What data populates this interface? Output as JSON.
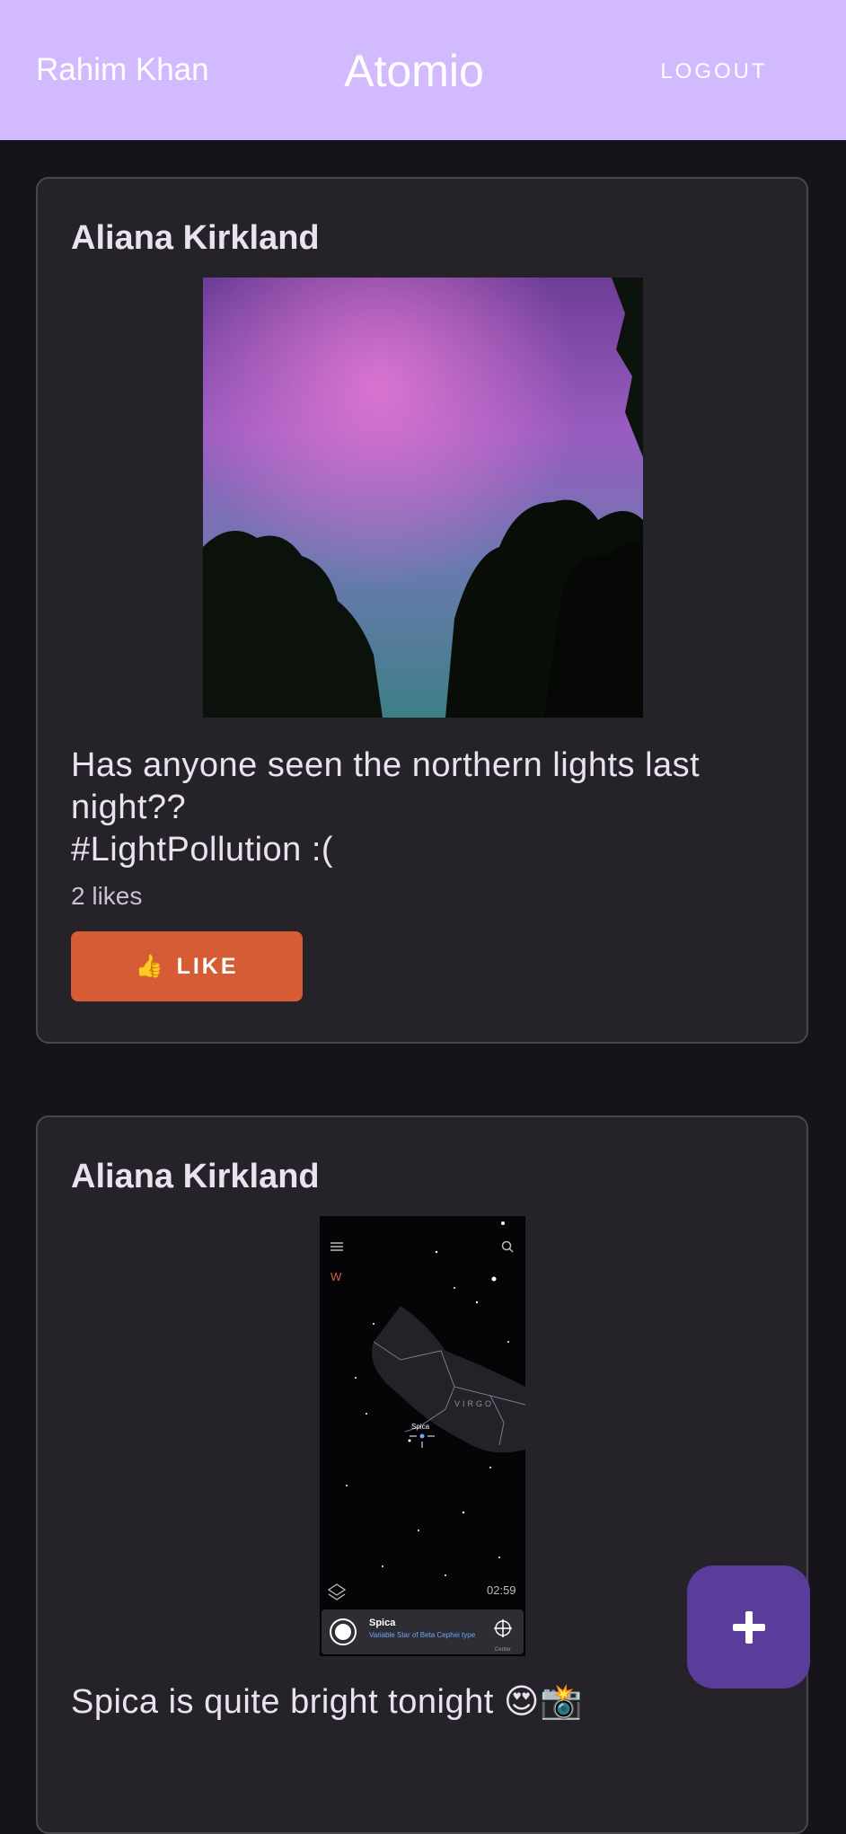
{
  "appbar": {
    "user_name": "Rahim Khan",
    "app_title": "Atomio",
    "logout_label": "LOGOUT",
    "background": "#d2baff"
  },
  "posts": [
    {
      "author": "Aliana Kirkland",
      "text_line1": "Has anyone seen the northern lights last",
      "text_line2": "night??",
      "text_line3": "#LightPollution :(",
      "likes": "2 likes",
      "like_icon": "👍",
      "like_label": "LIKE",
      "image_description_icon": "aurora-photo"
    },
    {
      "author": "Aliana Kirkland",
      "text": "Spica is quite bright tonight 😍📸",
      "screenshot": {
        "compass": "W",
        "constellation": "VIRGO",
        "star_label": "Spica",
        "time": "02:59",
        "panel_title": "Spica",
        "panel_subtitle": "Variable Star of Beta Cephei type",
        "panel_action": "Center"
      }
    }
  ],
  "fab": {
    "icon": "plus-icon",
    "color": "#5a3d9a"
  },
  "colors": {
    "background": "#16141a",
    "card": "#25222a",
    "like_button": "#d55c35"
  }
}
